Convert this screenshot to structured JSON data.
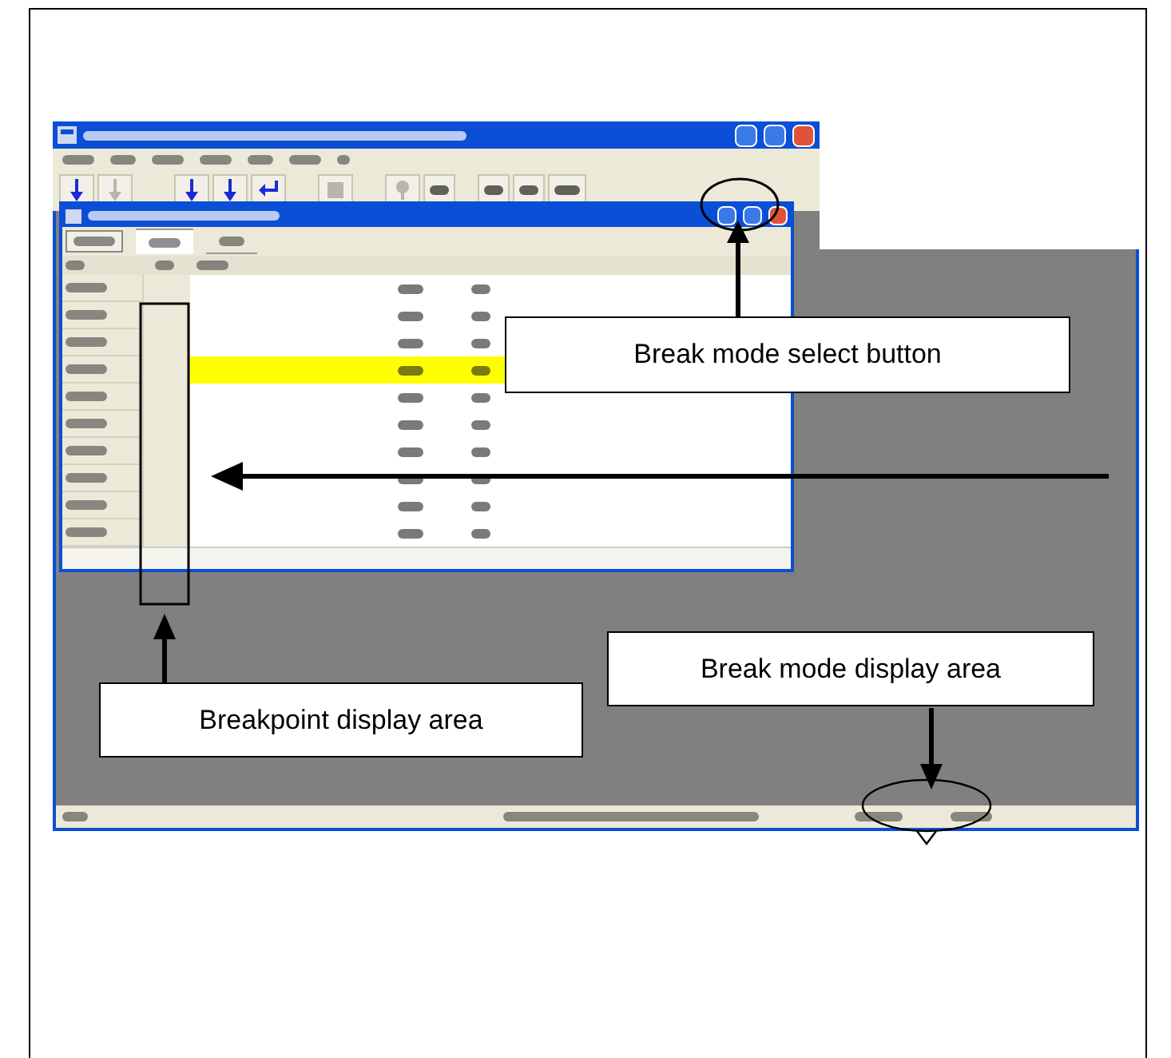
{
  "program_rows": [
    {
      "highlighted": false
    },
    {
      "highlighted": false
    },
    {
      "highlighted": false
    },
    {
      "highlighted": true
    },
    {
      "highlighted": false
    },
    {
      "highlighted": false
    },
    {
      "highlighted": false
    },
    {
      "highlighted": false
    },
    {
      "highlighted": false
    },
    {
      "highlighted": false
    }
  ],
  "callouts": [
    {
      "text": "Break mode select button"
    },
    {
      "text": "Breakpoint display area"
    },
    {
      "text": "Break mode display area"
    }
  ]
}
